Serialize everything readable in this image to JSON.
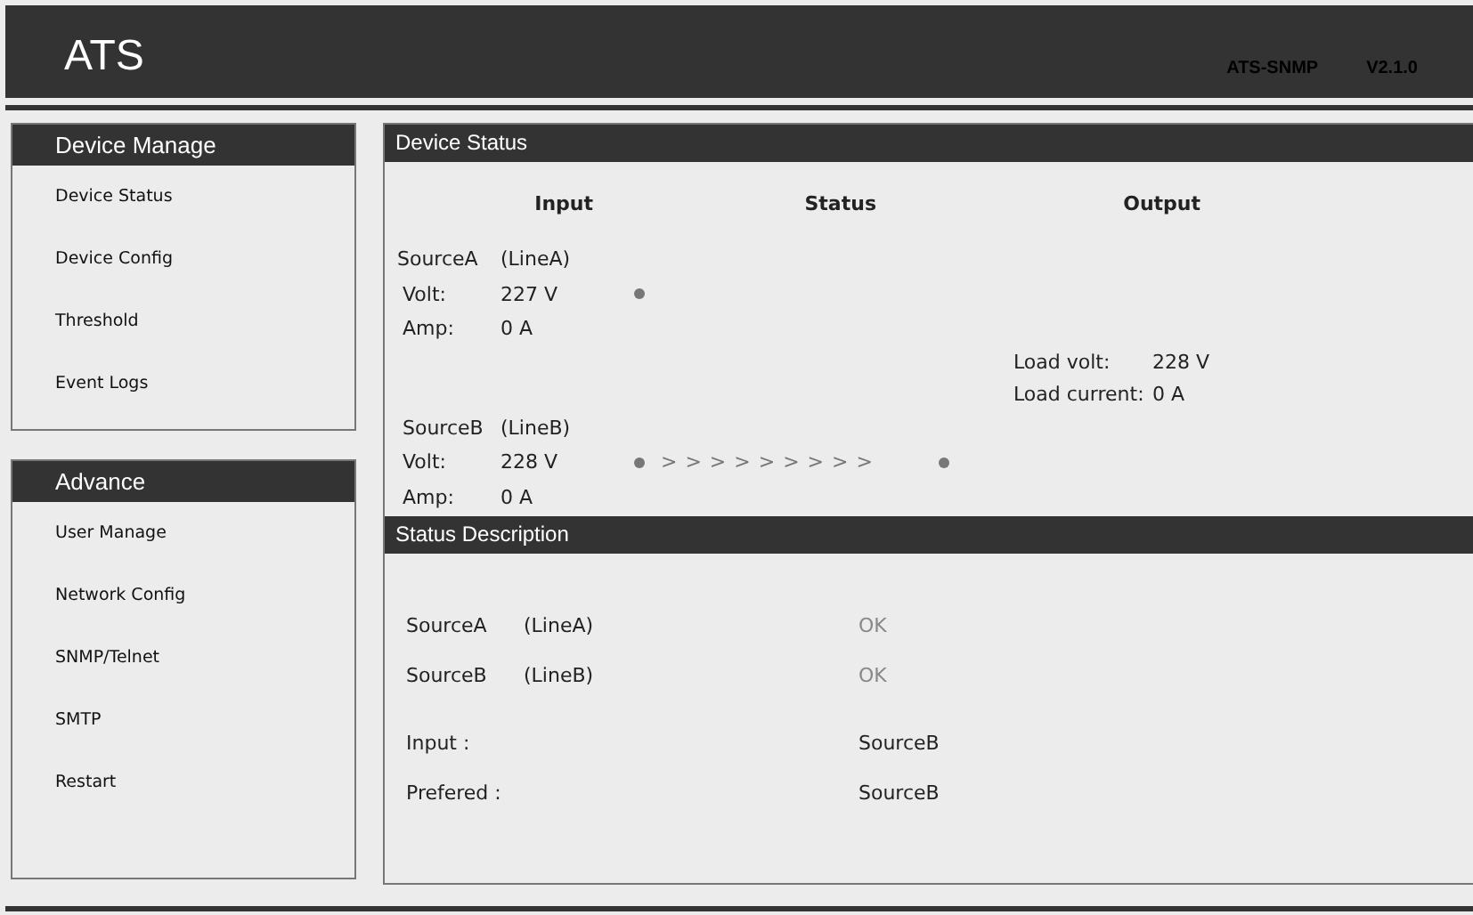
{
  "header": {
    "logo": "ATS",
    "product": "ATS-SNMP",
    "version": "V2.1.0"
  },
  "sidebar": [
    {
      "title": "Device Manage",
      "items": [
        "Device Status",
        "Device Config",
        "Threshold",
        "Event Logs"
      ]
    },
    {
      "title": "Advance",
      "items": [
        "User Manage",
        "Network Config",
        "SNMP/Telnet",
        "SMTP",
        "Restart"
      ]
    }
  ],
  "device_status": {
    "title": "Device Status",
    "columns": [
      "Input",
      "Status",
      "Output"
    ],
    "source_a": {
      "name": "SourceA",
      "line": "(LineA)",
      "volt_label": "Volt:",
      "volt": "227 V",
      "amp_label": "Amp:",
      "amp": "0 A"
    },
    "output": {
      "load_volt_label": "Load volt:",
      "load_volt": "228 V",
      "load_current_label": "Load current:",
      "load_current": "0 A"
    },
    "source_b": {
      "name": "SourceB",
      "line": "(LineB)",
      "volt_label": "Volt:",
      "volt": "228 V",
      "amp_label": "Amp:",
      "amp": "0 A"
    },
    "transfer_arrows": "> > > > > > > > >"
  },
  "status_description": {
    "title": "Status Description",
    "sources": [
      {
        "name": "SourceA",
        "line": "(LineA)",
        "status": "OK"
      },
      {
        "name": "SourceB",
        "line": "(LineB)",
        "status": "OK"
      }
    ],
    "fields": [
      {
        "label": "Input :",
        "value": "SourceB"
      },
      {
        "label": "Prefered :",
        "value": "SourceB"
      }
    ]
  }
}
